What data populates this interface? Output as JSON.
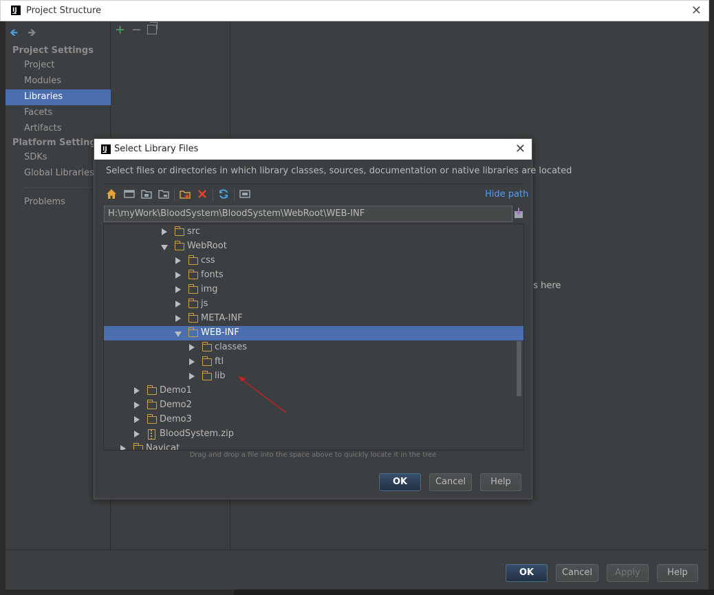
{
  "window": {
    "title": "Project Structure",
    "close_glyph": "✕"
  },
  "sidebar": {
    "back_glyph": "🡸",
    "forward_glyph": "🡺",
    "project_settings_header": "Project Settings",
    "platform_settings_header": "Platform Settings",
    "items": [
      {
        "label": "Project"
      },
      {
        "label": "Modules"
      },
      {
        "label": "Libraries",
        "selected": true
      },
      {
        "label": "Facets"
      },
      {
        "label": "Artifacts"
      },
      {
        "label": "SDKs"
      },
      {
        "label": "Global Libraries"
      },
      {
        "label": "Problems"
      }
    ]
  },
  "middle_toolbar": {
    "add_glyph": "+",
    "remove_glyph": "−"
  },
  "main": {
    "placeholder_partial": "ils here"
  },
  "footer": {
    "ok_label": "OK",
    "cancel_label": "Cancel",
    "apply_label": "Apply",
    "help_label": "Help"
  },
  "dialog": {
    "title": "Select Library Files",
    "close_glyph": "✕",
    "description": "Select files or directories in which library classes, sources, documentation or native libraries are located",
    "hide_path_label": "Hide path",
    "path_value": "H:\\myWork\\BloodSystem\\BloodSystem\\WebRoot\\WEB-INF",
    "tree": [
      {
        "label": "src",
        "expanded": false,
        "level": 3,
        "kind": "folder"
      },
      {
        "label": "WebRoot",
        "expanded": true,
        "level": 3,
        "kind": "folder"
      },
      {
        "label": "css",
        "expanded": false,
        "level": 4,
        "kind": "folder"
      },
      {
        "label": "fonts",
        "expanded": false,
        "level": 4,
        "kind": "folder"
      },
      {
        "label": "img",
        "expanded": false,
        "level": 4,
        "kind": "folder"
      },
      {
        "label": "js",
        "expanded": false,
        "level": 4,
        "kind": "folder"
      },
      {
        "label": "META-INF",
        "expanded": false,
        "level": 4,
        "kind": "folder"
      },
      {
        "label": "WEB-INF",
        "expanded": true,
        "level": 4,
        "kind": "folder",
        "selected": true
      },
      {
        "label": "classes",
        "expanded": false,
        "level": 5,
        "kind": "folder"
      },
      {
        "label": "ftl",
        "expanded": false,
        "level": 5,
        "kind": "folder"
      },
      {
        "label": "lib",
        "expanded": false,
        "level": 5,
        "kind": "folder"
      },
      {
        "label": "Demo1",
        "expanded": false,
        "level": 2,
        "kind": "folder"
      },
      {
        "label": "Demo2",
        "expanded": false,
        "level": 2,
        "kind": "folder"
      },
      {
        "label": "Demo3",
        "expanded": false,
        "level": 2,
        "kind": "folder"
      },
      {
        "label": "BloodSystem.zip",
        "expanded": false,
        "level": 2,
        "kind": "zip"
      },
      {
        "label": "Navicat",
        "expanded": false,
        "level": 1,
        "kind": "folder"
      }
    ],
    "hint": "Drag and drop a file into the space above to quickly locate it in the tree",
    "ok_label": "OK",
    "cancel_label": "Cancel",
    "help_label": "Help"
  },
  "colors": {
    "selection": "#4b6eaf",
    "folder": "#d0a23f",
    "link": "#589df6",
    "annotation_arrow": "#cc2222"
  }
}
